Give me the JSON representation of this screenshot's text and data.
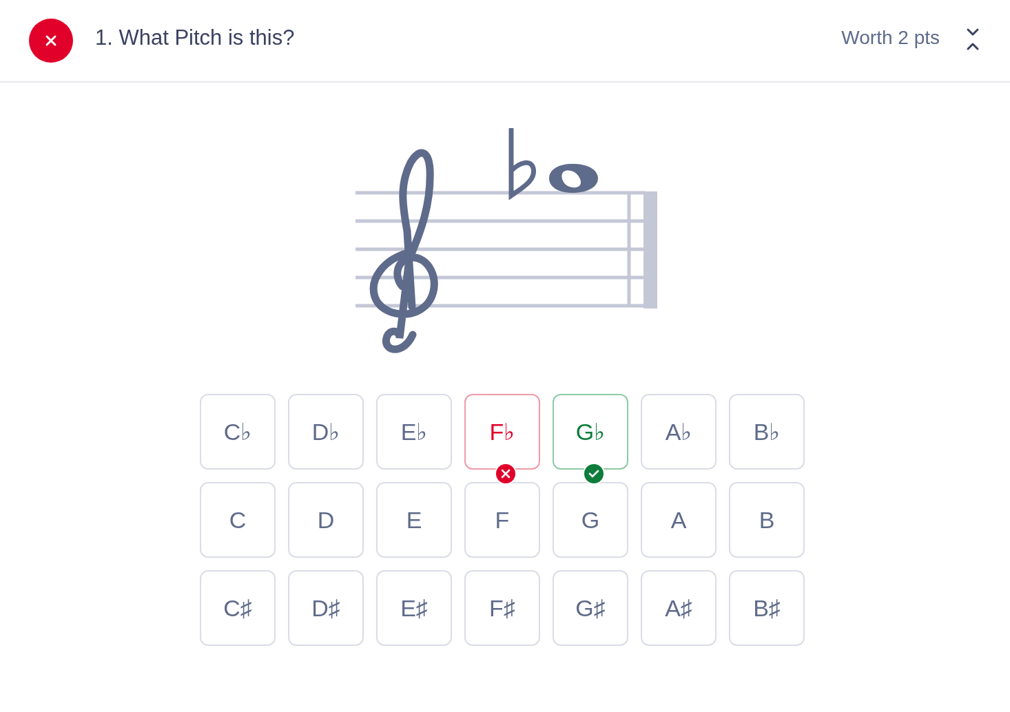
{
  "question": {
    "correct": false,
    "title": "1. What Pitch is this?",
    "worth": "Worth 2 pts"
  },
  "answers": [
    {
      "label": "C♭",
      "selected": false,
      "correct": false
    },
    {
      "label": "D♭",
      "selected": false,
      "correct": false
    },
    {
      "label": "E♭",
      "selected": false,
      "correct": false
    },
    {
      "label": "F♭",
      "selected": true,
      "correct": false
    },
    {
      "label": "G♭",
      "selected": false,
      "correct": true
    },
    {
      "label": "A♭",
      "selected": false,
      "correct": false
    },
    {
      "label": "B♭",
      "selected": false,
      "correct": false
    },
    {
      "label": "C",
      "selected": false,
      "correct": false
    },
    {
      "label": "D",
      "selected": false,
      "correct": false
    },
    {
      "label": "E",
      "selected": false,
      "correct": false
    },
    {
      "label": "F",
      "selected": false,
      "correct": false
    },
    {
      "label": "G",
      "selected": false,
      "correct": false
    },
    {
      "label": "A",
      "selected": false,
      "correct": false
    },
    {
      "label": "B",
      "selected": false,
      "correct": false
    },
    {
      "label": "C♯",
      "selected": false,
      "correct": false
    },
    {
      "label": "D♯",
      "selected": false,
      "correct": false
    },
    {
      "label": "E♯",
      "selected": false,
      "correct": false
    },
    {
      "label": "F♯",
      "selected": false,
      "correct": false
    },
    {
      "label": "G♯",
      "selected": false,
      "correct": false
    },
    {
      "label": "A♯",
      "selected": false,
      "correct": false
    },
    {
      "label": "B♯",
      "selected": false,
      "correct": false
    }
  ]
}
